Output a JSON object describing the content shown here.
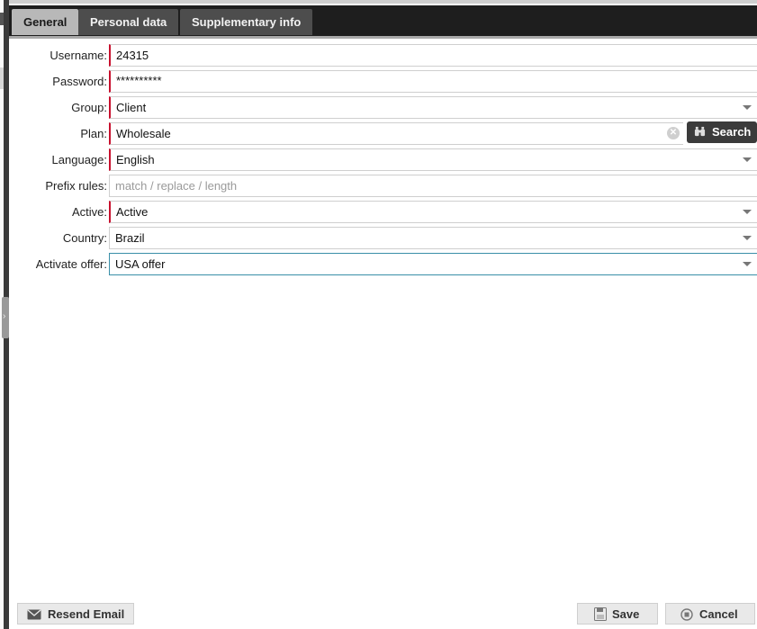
{
  "tabs": [
    {
      "label": "General"
    },
    {
      "label": "Personal data"
    },
    {
      "label": "Supplementary info"
    }
  ],
  "form": {
    "username": {
      "label": "Username:",
      "value": "24315"
    },
    "password": {
      "label": "Password:",
      "value": "**********"
    },
    "group": {
      "label": "Group:",
      "value": "Client"
    },
    "plan": {
      "label": "Plan:",
      "value": "Wholesale",
      "search_label": "Search"
    },
    "language": {
      "label": "Language:",
      "value": "English"
    },
    "prefix_rules": {
      "label": "Prefix rules:",
      "placeholder": "match / replace / length"
    },
    "active": {
      "label": "Active:",
      "value": "Active"
    },
    "country": {
      "label": "Country:",
      "value": "Brazil"
    },
    "activate_offer": {
      "label": "Activate offer:",
      "value": "USA offer"
    }
  },
  "footer": {
    "resend_email": "Resend Email",
    "save": "Save",
    "cancel": "Cancel"
  },
  "colors": {
    "tabbar": "#1e1e1e",
    "active_tab": "#b8b8b8",
    "required": "#c8102e",
    "focus": "#3a8fa8"
  }
}
